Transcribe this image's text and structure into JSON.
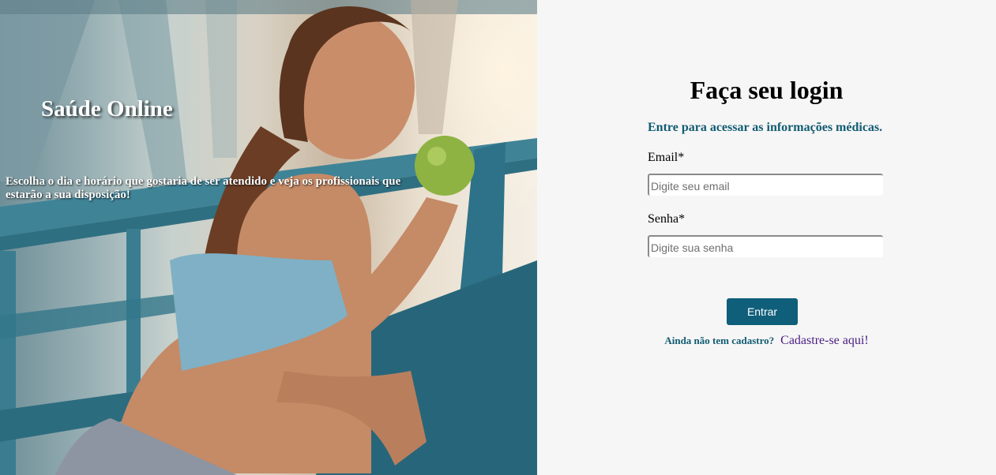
{
  "hero": {
    "title": "Saúde Online",
    "description": "Escolha o dia e horário que gostaria de ser atendido e veja os profissionais que estarão a sua disposição!"
  },
  "login": {
    "title": "Faça seu login",
    "subtitle": "Entre para acessar as informações médicas.",
    "email_label": "Email*",
    "email_placeholder": "Digite seu email",
    "email_value": "",
    "password_label": "Senha*",
    "password_placeholder": "Digite sua senha",
    "password_value": "",
    "submit_label": "Entrar",
    "signup_question": "Ainda não tem cadastro?",
    "signup_link": "Cadastre-se aqui!"
  },
  "colors": {
    "accent": "#0f5f7b",
    "subtitle": "#115b72",
    "link": "#4a1d82",
    "panel_background": "#f6f6f6"
  }
}
